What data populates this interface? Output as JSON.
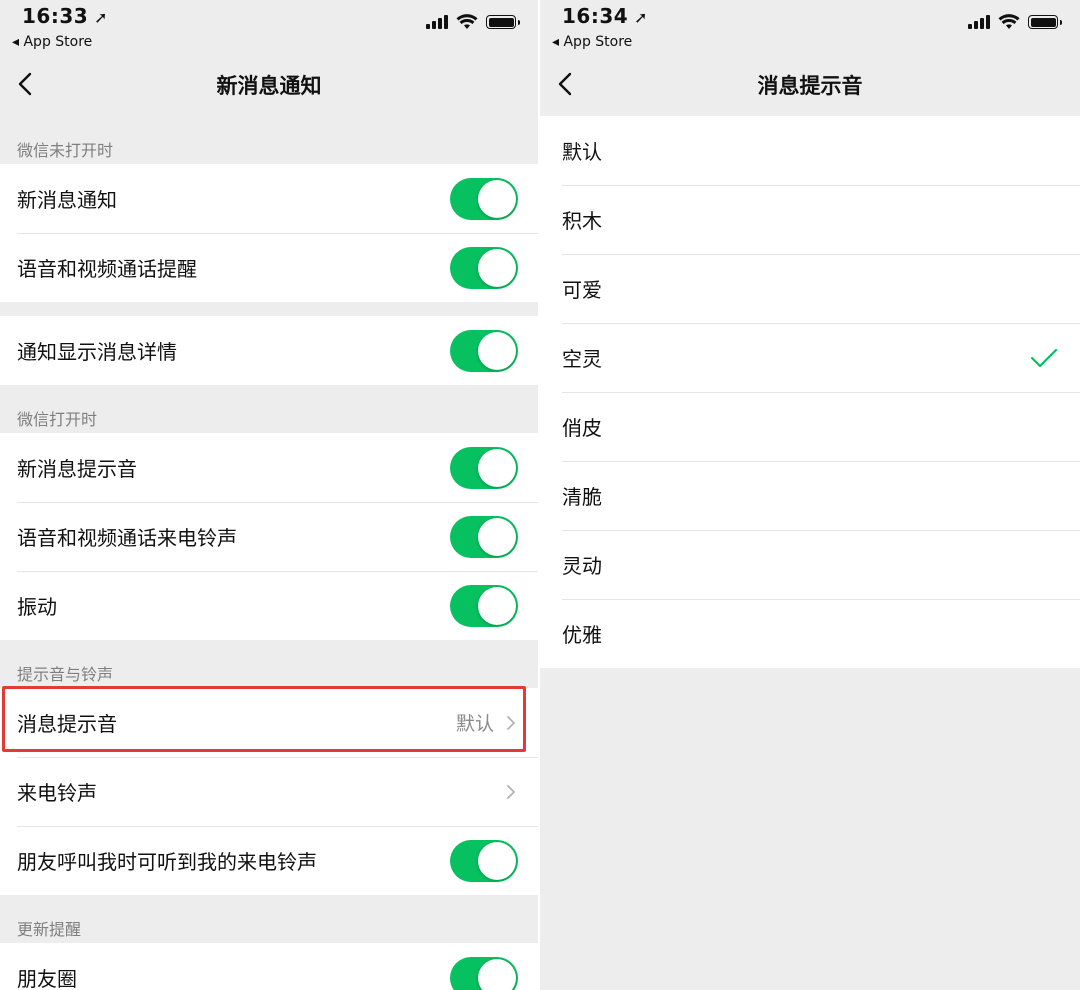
{
  "left": {
    "status": {
      "time": "16:33",
      "back_app": "App Store"
    },
    "nav_title": "新消息通知",
    "sections": [
      {
        "header": "微信未打开时",
        "rows": [
          {
            "label": "新消息通知",
            "toggle": true
          },
          {
            "label": "语音和视频通话提醒",
            "toggle": true
          }
        ]
      },
      {
        "header": "",
        "rows": [
          {
            "label": "通知显示消息详情",
            "toggle": true
          }
        ]
      },
      {
        "header": "微信打开时",
        "rows": [
          {
            "label": "新消息提示音",
            "toggle": true
          },
          {
            "label": "语音和视频通话来电铃声",
            "toggle": true
          },
          {
            "label": "振动",
            "toggle": true
          }
        ]
      },
      {
        "header": "提示音与铃声",
        "rows": [
          {
            "label": "消息提示音",
            "value": "默认"
          },
          {
            "label": "来电铃声",
            "value": ""
          },
          {
            "label": "朋友呼叫我时可听到我的来电铃声",
            "toggle": true
          }
        ]
      },
      {
        "header": "更新提醒",
        "rows": [
          {
            "label": "朋友圈",
            "toggle": true
          }
        ]
      }
    ]
  },
  "right": {
    "status": {
      "time": "16:34",
      "back_app": "App Store"
    },
    "nav_title": "消息提示音",
    "options": [
      "默认",
      "积木",
      "可爱",
      "空灵",
      "俏皮",
      "清脆",
      "灵动",
      "优雅"
    ],
    "selected": "空灵"
  },
  "colors": {
    "accent": "#07c160",
    "highlight": "#e53935",
    "background": "#ededed"
  },
  "icons": [
    "location-arrow-icon",
    "signal-icon",
    "wifi-icon",
    "battery-icon",
    "back-chevron-icon",
    "chevron-right-icon",
    "checkmark-icon"
  ]
}
